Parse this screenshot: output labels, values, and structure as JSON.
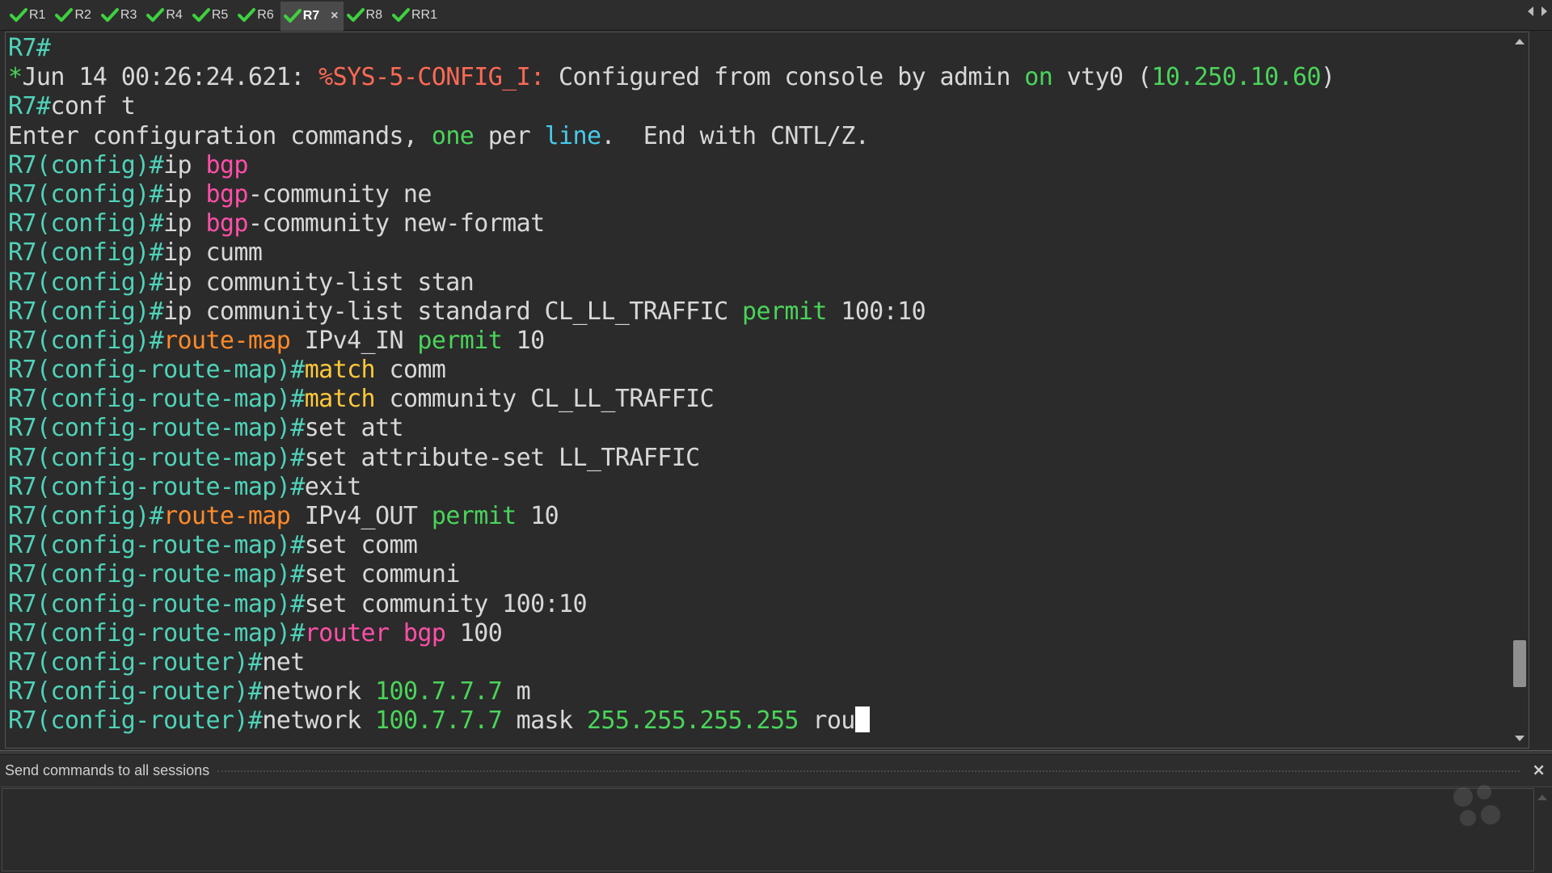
{
  "tabs": [
    {
      "label": "R1",
      "active": false
    },
    {
      "label": "R2",
      "active": false
    },
    {
      "label": "R3",
      "active": false
    },
    {
      "label": "R4",
      "active": false
    },
    {
      "label": "R5",
      "active": false
    },
    {
      "label": "R6",
      "active": false
    },
    {
      "label": "R7",
      "active": true
    },
    {
      "label": "R8",
      "active": false
    },
    {
      "label": "RR1",
      "active": false
    }
  ],
  "tab_close_glyph": "×",
  "colors": {
    "prompt": "#4fd2b8",
    "green": "#4ad45a",
    "cyan": "#48c9ea",
    "red": "#ff6a55",
    "pink": "#ff4fa8",
    "orange": "#ff8a2a",
    "yellow": "#ffc83a",
    "text": "#d8d8d8",
    "check": "#3fd13f"
  },
  "terminal": {
    "lines": [
      [
        [
          "prompt",
          "R7#"
        ]
      ],
      [
        [
          "green",
          "*"
        ],
        [
          "text",
          "Jun 14 00:26:24.621: "
        ],
        [
          "red",
          "%SYS-5-CONFIG_I:"
        ],
        [
          "text",
          " Configured from console by admin "
        ],
        [
          "green",
          "on"
        ],
        [
          "text",
          " vty0 ("
        ],
        [
          "green",
          "10.250.10.60"
        ],
        [
          "text",
          ")"
        ]
      ],
      [
        [
          "prompt",
          "R7#"
        ],
        [
          "text",
          "conf t"
        ]
      ],
      [
        [
          "text",
          "Enter configuration commands, "
        ],
        [
          "green",
          "one"
        ],
        [
          "text",
          " per "
        ],
        [
          "cyan",
          "line"
        ],
        [
          "text",
          ".  End with CNTL/Z."
        ]
      ],
      [
        [
          "prompt",
          "R7(config)#"
        ],
        [
          "text",
          "ip "
        ],
        [
          "pink",
          "bgp"
        ]
      ],
      [
        [
          "prompt",
          "R7(config)#"
        ],
        [
          "text",
          "ip "
        ],
        [
          "pink",
          "bgp"
        ],
        [
          "text",
          "-community ne"
        ]
      ],
      [
        [
          "prompt",
          "R7(config)#"
        ],
        [
          "text",
          "ip "
        ],
        [
          "pink",
          "bgp"
        ],
        [
          "text",
          "-community new-format"
        ]
      ],
      [
        [
          "prompt",
          "R7(config)#"
        ],
        [
          "text",
          "ip cumm"
        ]
      ],
      [
        [
          "prompt",
          "R7(config)#"
        ],
        [
          "text",
          "ip community-list stan"
        ]
      ],
      [
        [
          "prompt",
          "R7(config)#"
        ],
        [
          "text",
          "ip community-list standard CL_LL_TRAFFIC "
        ],
        [
          "green",
          "permit"
        ],
        [
          "text",
          " 100:10"
        ]
      ],
      [
        [
          "prompt",
          "R7(config)#"
        ],
        [
          "orange",
          "route-map"
        ],
        [
          "text",
          " IPv4_IN "
        ],
        [
          "green",
          "permit"
        ],
        [
          "text",
          " 10"
        ]
      ],
      [
        [
          "prompt",
          "R7(config-route-map)#"
        ],
        [
          "yellow",
          "match"
        ],
        [
          "text",
          " comm"
        ]
      ],
      [
        [
          "prompt",
          "R7(config-route-map)#"
        ],
        [
          "yellow",
          "match"
        ],
        [
          "text",
          " community CL_LL_TRAFFIC"
        ]
      ],
      [
        [
          "prompt",
          "R7(config-route-map)#"
        ],
        [
          "text",
          "set att"
        ]
      ],
      [
        [
          "prompt",
          "R7(config-route-map)#"
        ],
        [
          "text",
          "set attribute-set LL_TRAFFIC"
        ]
      ],
      [
        [
          "prompt",
          "R7(config-route-map)#"
        ],
        [
          "text",
          "exit"
        ]
      ],
      [
        [
          "prompt",
          "R7(config)#"
        ],
        [
          "orange",
          "route-map"
        ],
        [
          "text",
          " IPv4_OUT "
        ],
        [
          "green",
          "permit"
        ],
        [
          "text",
          " 10"
        ]
      ],
      [
        [
          "prompt",
          "R7(config-route-map)#"
        ],
        [
          "text",
          "set comm"
        ]
      ],
      [
        [
          "prompt",
          "R7(config-route-map)#"
        ],
        [
          "text",
          "set communi"
        ]
      ],
      [
        [
          "prompt",
          "R7(config-route-map)#"
        ],
        [
          "text",
          "set community 100:10"
        ]
      ],
      [
        [
          "prompt",
          "R7(config-route-map)#"
        ],
        [
          "pink",
          "router bgp"
        ],
        [
          "text",
          " 100"
        ]
      ],
      [
        [
          "prompt",
          "R7(config-router)#"
        ],
        [
          "text",
          "net"
        ]
      ],
      [
        [
          "prompt",
          "R7(config-router)#"
        ],
        [
          "text",
          "network "
        ],
        [
          "green",
          "100.7.7.7"
        ],
        [
          "text",
          " m"
        ]
      ],
      [
        [
          "prompt",
          "R7(config-router)#"
        ],
        [
          "text",
          "network "
        ],
        [
          "green",
          "100.7.7.7"
        ],
        [
          "text",
          " mask "
        ],
        [
          "green",
          "255.255.255.255"
        ],
        [
          "text",
          " rou"
        ]
      ]
    ],
    "scroll_position_fraction": 0.93
  },
  "send_panel": {
    "title": "Send commands to all sessions",
    "input_value": "",
    "close_glyph": "×"
  }
}
